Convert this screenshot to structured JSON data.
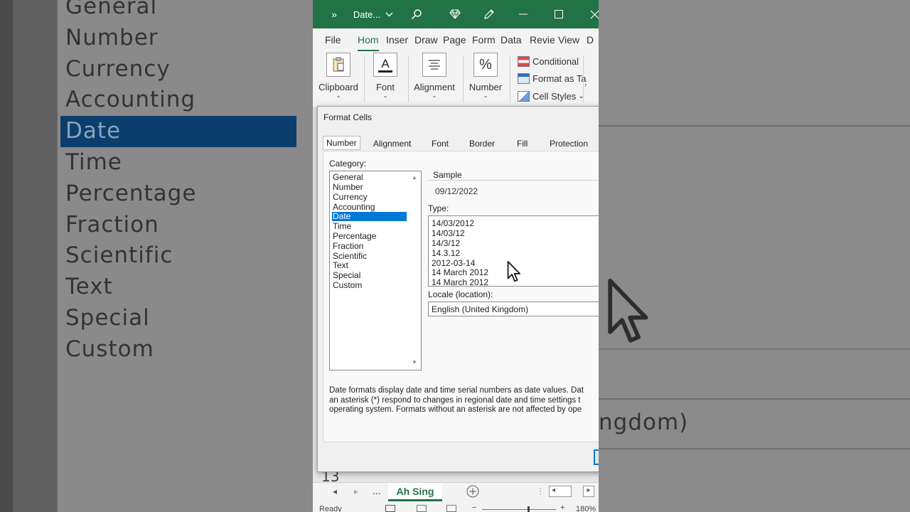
{
  "background": {
    "categories": [
      "General",
      "Number",
      "Currency",
      "Accounting",
      "Date",
      "Time",
      "Percentage",
      "Fraction",
      "Scientific",
      "Text",
      "Special",
      "Custom"
    ],
    "selected": "Date",
    "right_text": "ngdom)"
  },
  "excel": {
    "title": "Date...",
    "menu": [
      "File",
      "Hom",
      "Inser",
      "Draw",
      "Page",
      "Form",
      "Data",
      "Revie",
      "View",
      "D"
    ],
    "active_menu": "Hom",
    "ribbon": {
      "clipboard": "Clipboard",
      "font": "Font",
      "font_icon_letter": "A",
      "alignment": "Alignment",
      "number": "Number",
      "number_icon": "%",
      "conditional": "Conditional",
      "format_table": "Format as Ta",
      "cell_styles": "Cell Styles"
    },
    "row_number": "13",
    "sheet_tab": "Ah Sing",
    "more_sheets": "...",
    "status": "Ready",
    "zoom": "180%"
  },
  "dialog": {
    "title": "Format Cells",
    "tabs": [
      "Number",
      "Alignment",
      "Font",
      "Border",
      "Fill",
      "Protection"
    ],
    "active_tab": "Number",
    "category_label": "Category:",
    "categories": [
      "General",
      "Number",
      "Currency",
      "Accounting",
      "Date",
      "Time",
      "Percentage",
      "Fraction",
      "Scientific",
      "Text",
      "Special",
      "Custom"
    ],
    "selected_category": "Date",
    "sample_label": "Sample",
    "sample_value": "09/12/2022",
    "type_label": "Type:",
    "types": [
      "14/03/2012",
      "14/03/12",
      "14/3/12",
      "14.3.12",
      "2012-03-14",
      "14 March 2012",
      "14 March 2012"
    ],
    "locale_label": "Locale (location):",
    "locale_value": "English (United Kingdom)",
    "description": [
      "Date formats display date and time serial numbers as date values.  Dat",
      "an asterisk (*) respond to changes in regional date and time settings t",
      "operating system. Formats without an asterisk are not affected by ope"
    ]
  }
}
